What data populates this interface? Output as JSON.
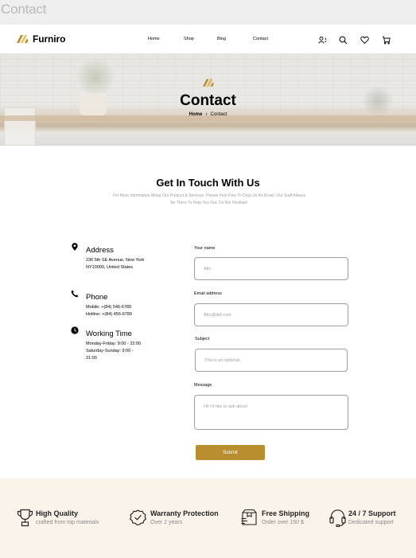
{
  "frame_label": "Contact",
  "brand": {
    "name": "Furniro",
    "accent": "#b88e2f"
  },
  "nav": {
    "links": [
      "Home",
      "Shop",
      "Blog",
      "Contact"
    ],
    "icons": [
      "account-alert-icon",
      "search-icon",
      "heart-icon",
      "cart-icon"
    ]
  },
  "hero": {
    "title": "Contact",
    "breadcrumb_home": "Home",
    "breadcrumb_separator": "›",
    "breadcrumb_current": "Contact"
  },
  "section": {
    "title": "Get In Touch With Us",
    "subtitle": "For More Information About Our Product & Services. Please Feel Free To Drop Us An Email. Our Staff Always Be There To Help You Out. Do Not Hesitate!"
  },
  "info": [
    {
      "icon": "location-pin-icon",
      "title": "Address",
      "lines": "236 5th SE Avenue, New York NY10000, United States"
    },
    {
      "icon": "phone-icon",
      "title": "Phone",
      "lines": "Mobile: +(84) 546-6789 Hotline: +(84) 456-6789"
    },
    {
      "icon": "clock-icon",
      "title": "Working Time",
      "lines": "Monday-Friday: 9:00 - 22:00 Saturday-Sunday: 9:00 - 21:00"
    }
  ],
  "form": {
    "name_label": "Your name",
    "name_placeholder": "Abc",
    "email_label": "Email address",
    "email_placeholder": "Abc@def.com",
    "subject_label": "Subject",
    "subject_placeholder": "This is an optional",
    "message_label": "Message",
    "message_placeholder": "Hi! i'd like to ask about",
    "submit_label": "Submit"
  },
  "features": [
    {
      "icon": "trophy-icon",
      "title": "High Quality",
      "subtitle": "crafted from top materials"
    },
    {
      "icon": "guarantee-check-icon",
      "title": "Warranty Protection",
      "subtitle": "Over 2 years"
    },
    {
      "icon": "shipping-box-icon",
      "title": "Free Shipping",
      "subtitle": "Order over 150 $"
    },
    {
      "icon": "support-headset-icon",
      "title": "24 / 7 Support",
      "subtitle": "Dedicated support"
    }
  ],
  "colors": {
    "features_bg": "#faf3ea",
    "muted_text": "#9f9f9f",
    "submit_bg": "#b88e2f"
  }
}
